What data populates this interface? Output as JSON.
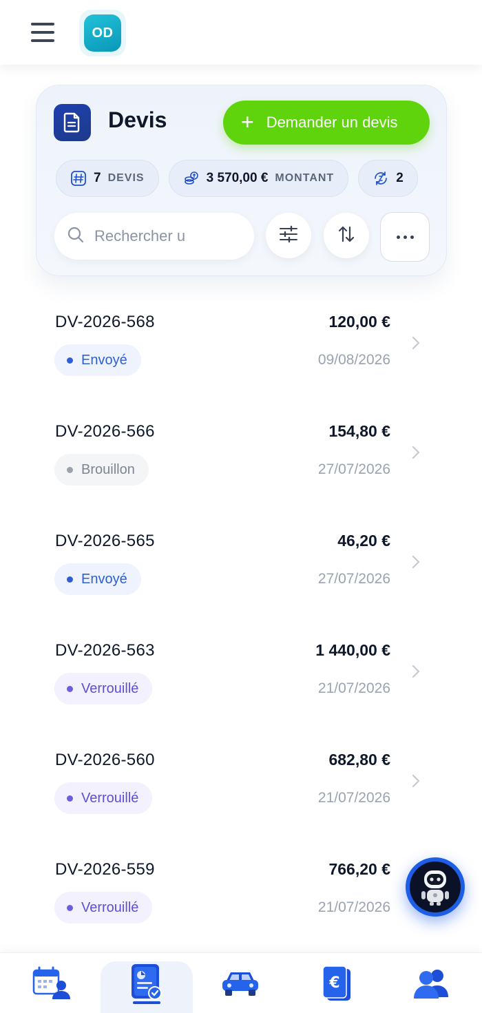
{
  "header": {
    "avatar_initials": "OD"
  },
  "card": {
    "title": "Devis",
    "cta_label": "Demander un devis",
    "stats": [
      {
        "value": "7",
        "label": "DEVIS",
        "icon": "hash-icon"
      },
      {
        "value": "3 570,00 €",
        "label": "MONTANT",
        "icon": "coins-icon"
      },
      {
        "value": "2",
        "label": "",
        "icon": "cycle-icon"
      }
    ],
    "search_placeholder": "Rechercher u"
  },
  "quotes": [
    {
      "ref": "DV-2026-568",
      "amount": "120,00 €",
      "date": "09/08/2026",
      "status": "Envoyé",
      "status_kind": "sent"
    },
    {
      "ref": "DV-2026-566",
      "amount": "154,80 €",
      "date": "27/07/2026",
      "status": "Brouillon",
      "status_kind": "draft"
    },
    {
      "ref": "DV-2026-565",
      "amount": "46,20 €",
      "date": "27/07/2026",
      "status": "Envoyé",
      "status_kind": "sent"
    },
    {
      "ref": "DV-2026-563",
      "amount": "1 440,00 €",
      "date": "21/07/2026",
      "status": "Verrouillé",
      "status_kind": "locked"
    },
    {
      "ref": "DV-2026-560",
      "amount": "682,80 €",
      "date": "21/07/2026",
      "status": "Verrouillé",
      "status_kind": "locked"
    },
    {
      "ref": "DV-2026-559",
      "amount": "766,20 €",
      "date": "21/07/2026",
      "status": "Verrouillé",
      "status_kind": "locked"
    }
  ],
  "bottom_nav": [
    {
      "icon": "calendar-user-icon",
      "active": false
    },
    {
      "icon": "quote-document-icon",
      "active": true
    },
    {
      "icon": "car-icon",
      "active": false
    },
    {
      "icon": "euro-invoice-icon",
      "active": false
    },
    {
      "icon": "users-icon",
      "active": false
    }
  ],
  "colors": {
    "accent": "#5fd40c",
    "primary": "#1e40af",
    "status_sent": "#2c5fd6",
    "status_draft": "#7d8593",
    "status_locked": "#5b4fd6"
  }
}
